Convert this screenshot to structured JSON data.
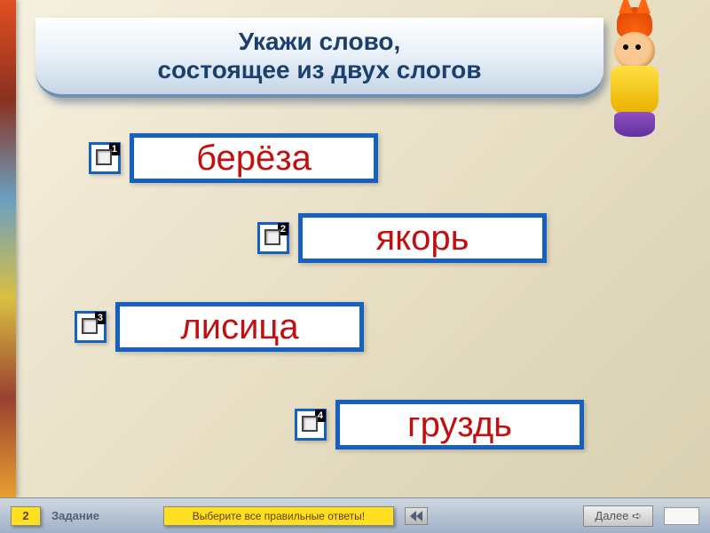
{
  "title": {
    "line1": "Укажи слово,",
    "line2": "состоящее из двух слогов"
  },
  "options": [
    {
      "num": "1",
      "word": "берёза"
    },
    {
      "num": "2",
      "word": "якорь"
    },
    {
      "num": "3",
      "word": "лисица"
    },
    {
      "num": "4",
      "word": "груздь"
    }
  ],
  "footer": {
    "task_number": "2",
    "task_label": "Задание",
    "hint": "Выберите все правильные ответы!",
    "next": "Далее"
  }
}
